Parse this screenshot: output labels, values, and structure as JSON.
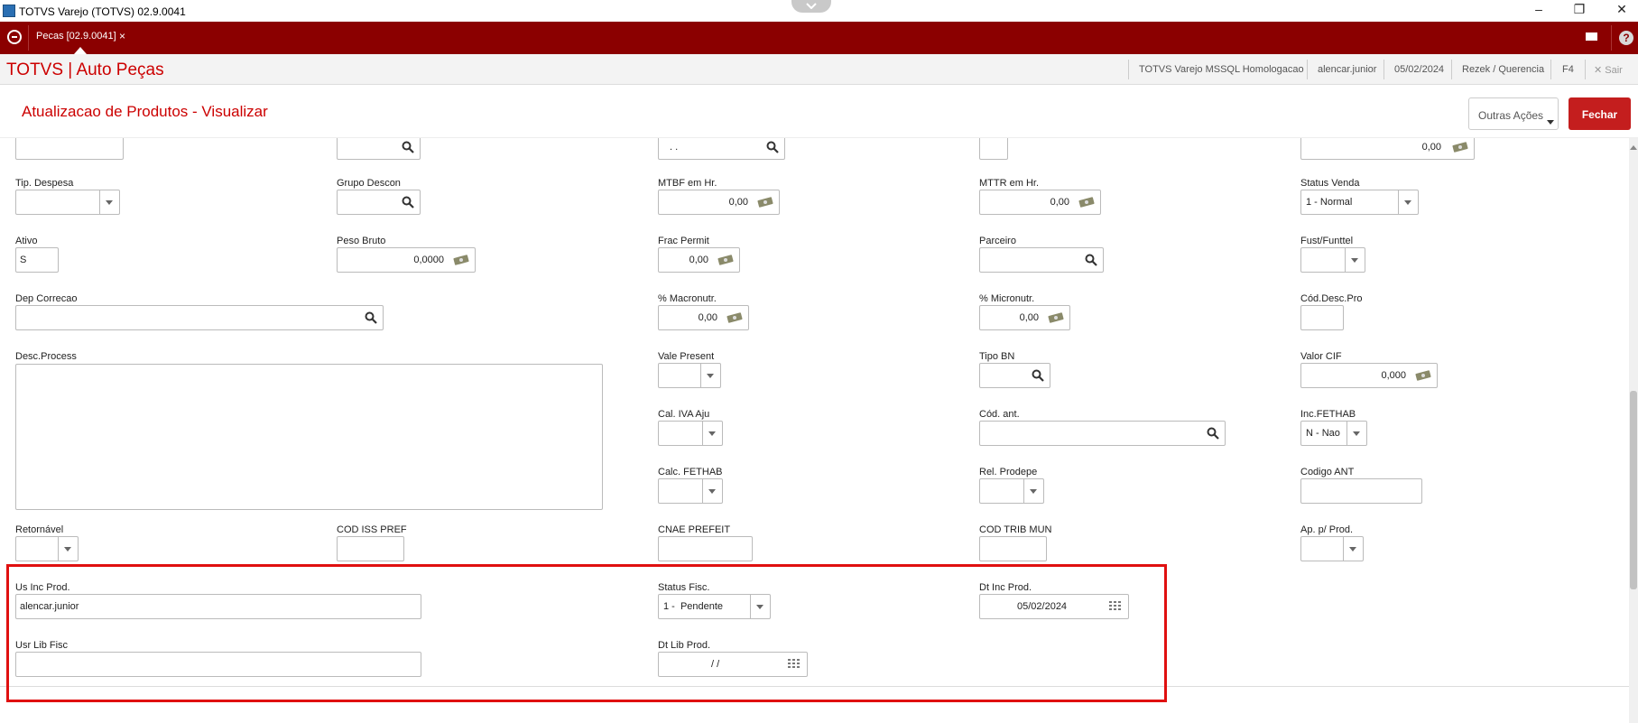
{
  "window": {
    "title": "TOTVS Varejo (TOTVS) 02.9.0041"
  },
  "tab": {
    "label": "Pecas [02.9.0041]",
    "close": "×"
  },
  "header": {
    "brand": "TOTVS | Auto Peças",
    "env": "TOTVS Varejo MSSQL Homologacao",
    "user": "alencar.junior",
    "date": "05/02/2024",
    "branch": "Rezek / Querencia",
    "key": "F4",
    "exit": "Sair"
  },
  "page": {
    "title": "Atualizacao de Produtos - Visualizar",
    "outras_label": "Outras Ações",
    "fechar_label": "Fechar"
  },
  "top_partial": {
    "col3_value": ". .",
    "col5_value": "0,00"
  },
  "fields": {
    "tip_despesa": {
      "label": "Tip. Despesa",
      "value": ""
    },
    "grupo_descon": {
      "label": "Grupo Descon",
      "value": ""
    },
    "mtbf": {
      "label": "MTBF em Hr.",
      "value": "0,00"
    },
    "mttr": {
      "label": "MTTR em Hr.",
      "value": "0,00"
    },
    "status_venda": {
      "label": "Status Venda",
      "value": "1 - Normal"
    },
    "ativo": {
      "label": "Ativo",
      "value": "S"
    },
    "peso_bruto": {
      "label": "Peso Bruto",
      "value": "0,0000"
    },
    "frac_permit": {
      "label": "Frac Permit",
      "value": "0,00"
    },
    "parceiro": {
      "label": "Parceiro",
      "value": ""
    },
    "fust_funttel": {
      "label": "Fust/Funttel",
      "value": ""
    },
    "dep_correcao": {
      "label": "Dep Correcao",
      "value": ""
    },
    "macronutr": {
      "label": "% Macronutr.",
      "value": "0,00"
    },
    "micronutr": {
      "label": "% Micronutr.",
      "value": "0,00"
    },
    "cod_desc_pro": {
      "label": "Cód.Desc.Pro",
      "value": ""
    },
    "desc_process": {
      "label": "Desc.Process",
      "value": ""
    },
    "vale_present": {
      "label": "Vale Present",
      "value": ""
    },
    "tipo_bn": {
      "label": "Tipo BN",
      "value": ""
    },
    "valor_cif": {
      "label": "Valor CIF",
      "value": "0,000"
    },
    "cal_iva_aju": {
      "label": "Cal. IVA Aju",
      "value": ""
    },
    "cod_ant": {
      "label": "Cód. ant.",
      "value": ""
    },
    "inc_fethab": {
      "label": "Inc.FETHAB",
      "value": "N - Nao"
    },
    "calc_fethab": {
      "label": "Calc. FETHAB",
      "value": ""
    },
    "rel_prodepe": {
      "label": "Rel. Prodepe",
      "value": ""
    },
    "codigo_ant": {
      "label": "Codigo ANT",
      "value": ""
    },
    "retornavel": {
      "label": "Retornável",
      "value": ""
    },
    "cod_iss_pref": {
      "label": "COD ISS PREF",
      "value": ""
    },
    "cnae_prefeit": {
      "label": "CNAE PREFEIT",
      "value": ""
    },
    "cod_trib_mun": {
      "label": "COD TRIB MUN",
      "value": ""
    },
    "ap_p_prod": {
      "label": "Ap. p/ Prod.",
      "value": ""
    },
    "us_inc_prod": {
      "label": "Us Inc Prod.",
      "value": "alencar.junior"
    },
    "status_fisc": {
      "label": "Status Fisc.",
      "value": "1 -  Pendente"
    },
    "dt_inc_prod": {
      "label": "Dt Inc Prod.",
      "value": "05/02/2024"
    },
    "usr_lib_fisc": {
      "label": "Usr Lib Fisc",
      "value": ""
    },
    "dt_lib_prod": {
      "label": "Dt Lib Prod.",
      "value": "/ /"
    }
  },
  "colors": {
    "brand_red": "#8b0000",
    "accent_red": "#c41e1e",
    "highlight": "#e01010"
  }
}
